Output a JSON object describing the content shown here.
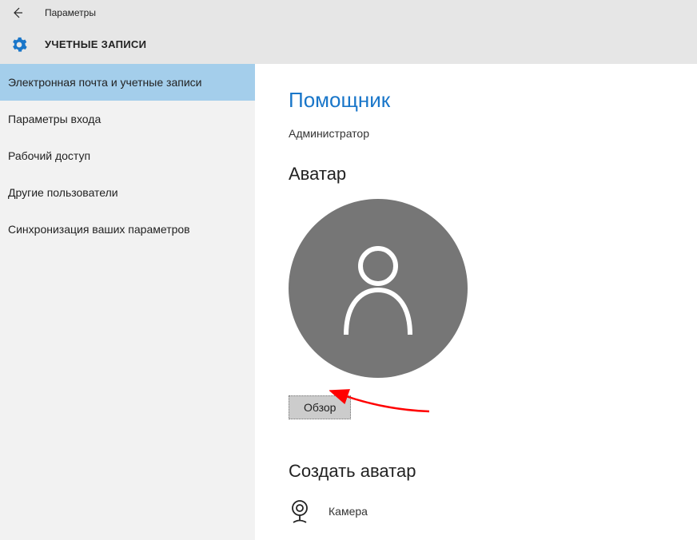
{
  "titlebar": {
    "title": "Параметры"
  },
  "header": {
    "title": "УЧЕТНЫЕ ЗАПИСИ"
  },
  "sidebar": {
    "items": [
      {
        "label": "Электронная почта и учетные записи",
        "selected": true
      },
      {
        "label": "Параметры входа",
        "selected": false
      },
      {
        "label": "Рабочий доступ",
        "selected": false
      },
      {
        "label": "Другие пользователи",
        "selected": false
      },
      {
        "label": "Синхронизация ваших параметров",
        "selected": false
      }
    ]
  },
  "main": {
    "user_name": "Помощник",
    "user_role": "Администратор",
    "avatar_section": "Аватар",
    "browse_button": "Обзор",
    "create_avatar_section": "Создать аватар",
    "camera_label": "Камера"
  },
  "colors": {
    "accent": "#1976c9",
    "sidebar_selected": "#a4ceeb",
    "avatar_gray": "#767676",
    "annotation_red": "#ff0000"
  }
}
